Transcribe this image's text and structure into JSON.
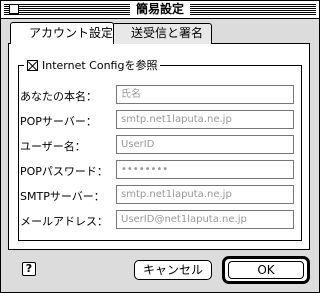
{
  "window": {
    "title": "簡易設定"
  },
  "tabs": [
    {
      "label": "アカウント設定",
      "active": true
    },
    {
      "label": "送受信と署名",
      "active": false
    }
  ],
  "internet_config": {
    "label": "Internet Configを参照",
    "checked": true
  },
  "fields": [
    {
      "label": "あなたの本名：",
      "placeholder": "氏名"
    },
    {
      "label": "POPサーバー：",
      "placeholder": "smtp.net1laputa.ne.jp"
    },
    {
      "label": "ユーザー名：",
      "placeholder": "UserID"
    },
    {
      "label": "POPパスワード：",
      "placeholder": "••••••••"
    },
    {
      "label": "SMTPサーバー：",
      "placeholder": "smtp.net1laputa.ne.jp"
    },
    {
      "label": "メールアドレス：",
      "placeholder": "UserID@net1laputa.ne.jp"
    }
  ],
  "buttons": {
    "help": "?",
    "cancel": "キャンセル",
    "ok": "OK"
  }
}
